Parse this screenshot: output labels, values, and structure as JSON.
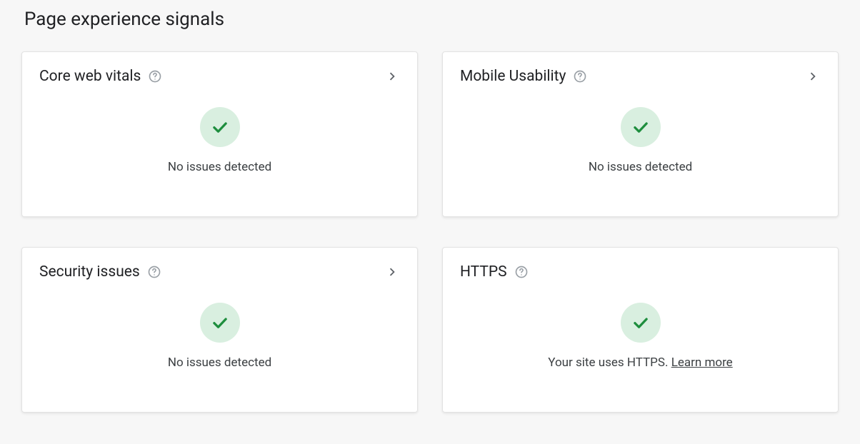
{
  "title": "Page experience signals",
  "cards": [
    {
      "id": "core-web-vitals",
      "title": "Core web vitals",
      "hasChevron": true,
      "status": "No issues detected",
      "link": null
    },
    {
      "id": "mobile-usability",
      "title": "Mobile Usability",
      "hasChevron": true,
      "status": "No issues detected",
      "link": null
    },
    {
      "id": "security-issues",
      "title": "Security issues",
      "hasChevron": true,
      "status": "No issues detected",
      "link": null
    },
    {
      "id": "https",
      "title": "HTTPS",
      "hasChevron": false,
      "status": "Your site uses HTTPS. ",
      "link": "Learn more"
    }
  ]
}
